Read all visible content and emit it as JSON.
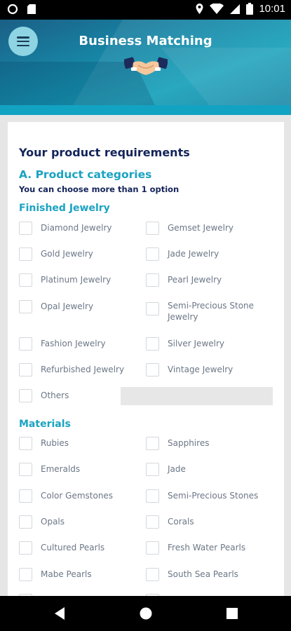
{
  "status_bar": {
    "time": "10:01"
  },
  "header": {
    "title": "Business Matching"
  },
  "form": {
    "title": "Your product requirements",
    "section_a": "A. Product categories",
    "hint": "You can choose more than 1 option",
    "finished_jewelry": {
      "title": "Finished Jewelry",
      "options": [
        "Diamond Jewelry",
        "Gemset Jewelry",
        "Gold Jewelry",
        "Jade Jewelry",
        "Platinum Jewelry",
        "Pearl Jewelry",
        "Opal Jewelry",
        "Semi-Precious Stone Jewelry",
        "Fashion Jewelry",
        "Silver Jewelry",
        "Refurbished Jewelry",
        "Vintage Jewelry",
        "Others"
      ]
    },
    "materials": {
      "title": "Materials",
      "options": [
        "Rubies",
        "Sapphires",
        "Emeralds",
        "Jade",
        "Color Gemstones",
        "Semi-Precious Stones",
        "Opals",
        "Corals",
        "Cultured Pearls",
        "Fresh Water Pearls",
        "Mabe Pearls",
        "South Sea Pearls"
      ]
    }
  },
  "icons": {
    "status_left": [
      "record-icon",
      "sd-card-icon"
    ],
    "status_right": [
      "location-icon",
      "wifi-icon",
      "signal-icon",
      "battery-icon"
    ],
    "nav": [
      "back-icon",
      "home-icon",
      "recents-icon"
    ]
  }
}
